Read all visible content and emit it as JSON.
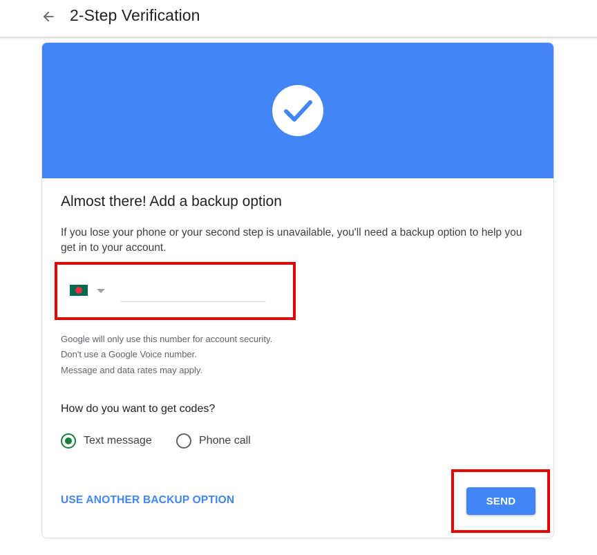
{
  "header": {
    "back_icon": "arrow-back-icon",
    "title": "2-Step Verification"
  },
  "colors": {
    "banner": "#4285f4",
    "primary": "#4285f4",
    "radio_checked": "#188038",
    "highlight": "#e60000"
  },
  "card": {
    "banner_icon": "checkmark-icon",
    "heading": "Almost there! Add a backup option",
    "description": "If you lose your phone or your second step is unavailable, you'll need a backup option to help you get in to your account.",
    "phone": {
      "country_flag": "bangladesh-flag-icon",
      "dropdown_icon": "caret-down-icon",
      "value": ""
    },
    "notes": [
      "Google will only use this number for account security.",
      "Don't use a Google Voice number.",
      "Message and data rates may apply."
    ],
    "question": "How do you want to get codes?",
    "options": [
      {
        "label": "Text message",
        "selected": true
      },
      {
        "label": "Phone call",
        "selected": false
      }
    ],
    "link_label": "USE ANOTHER BACKUP OPTION",
    "send_label": "SEND"
  }
}
